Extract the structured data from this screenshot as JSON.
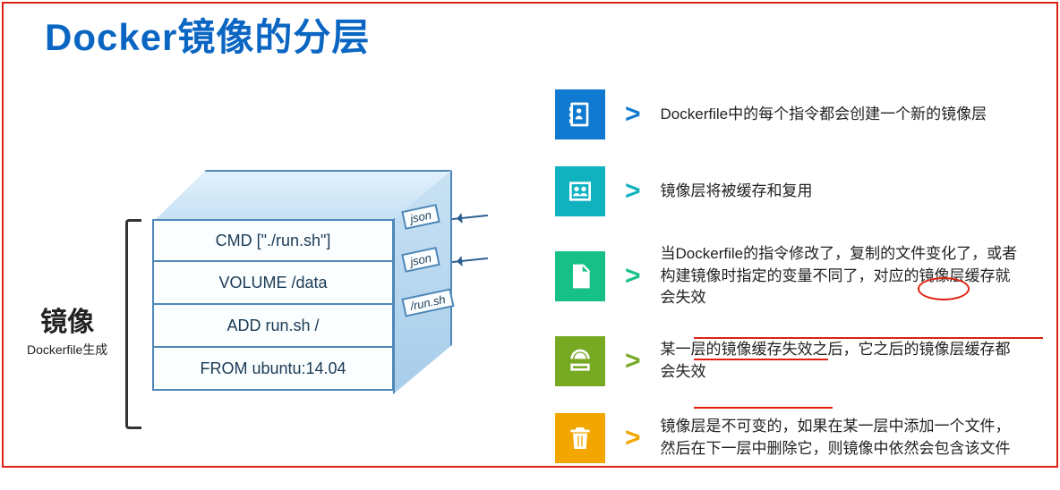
{
  "title": "Docker镜像的分层",
  "figure": {
    "side_label_big": "镜像",
    "side_label_small": "Dockerfile生成",
    "tags": {
      "json1": "json",
      "json2": "json",
      "runsh": "/run.sh"
    },
    "layers": {
      "l0": "CMD [\"./run.sh\"]",
      "l1": "VOLUME /data",
      "l2": "ADD run.sh /",
      "l3": "FROM ubuntu:14.04"
    }
  },
  "rows": {
    "r0": {
      "text": "Dockerfile中的每个指令都会创建一个新的镜像层",
      "chev": ">"
    },
    "r1": {
      "text": "镜像层将被缓存和复用",
      "chev": ">"
    },
    "r2": {
      "text": "当Dockerfile的指令修改了，复制的文件变化了，或者构建镜像时指定的变量不同了，对应的镜像层缓存就会失效",
      "chev": ">"
    },
    "r3": {
      "text": "某一层的镜像缓存失效之后，它之后的镜像层缓存都会失效",
      "chev": ">"
    },
    "r4": {
      "text": "镜像层是不可变的，如果在某一层中添加一个文件，然后在下一层中删除它，则镜像中依然会包含该文件",
      "chev": ">"
    }
  },
  "chart_data": {
    "type": "table",
    "title": "Docker镜像的分层",
    "stack_layers_top_to_bottom": [
      "CMD [\"./run.sh\"]",
      "VOLUME /data",
      "ADD run.sh /",
      "FROM ubuntu:14.04"
    ],
    "layer_metadata_arrows": [
      "json",
      "json",
      "/run.sh"
    ],
    "stack_label": "镜像 (Dockerfile生成)",
    "points": [
      {
        "icon": "contact-book",
        "color": "#0f7ad0",
        "text": "Dockerfile中的每个指令都会创建一个新的镜像层"
      },
      {
        "icon": "photo-people",
        "color": "#11b2c0",
        "text": "镜像层将被缓存和复用"
      },
      {
        "icon": "document",
        "color": "#17c086",
        "text": "当Dockerfile的指令修改了，复制的文件变化了，或者构建镜像时指定的变量不同了，对应的镜像层缓存就会失效"
      },
      {
        "icon": "globe-monitor",
        "color": "#77a923",
        "text": "某一层的镜像缓存失效之后，它之后的镜像层缓存都会失效"
      },
      {
        "icon": "trash",
        "color": "#f2a600",
        "text": "镜像层是不可变的，如果在某一层中添加一个文件，然后在下一层中删除它，则镜像中依然会包含该文件"
      }
    ],
    "hand_annotations": [
      "red circle around '失效' in point 3",
      "red underline under point 4 text",
      "red underline under '镜像层是不可变的' in point 5",
      "red rectangle border around entire slide"
    ]
  }
}
